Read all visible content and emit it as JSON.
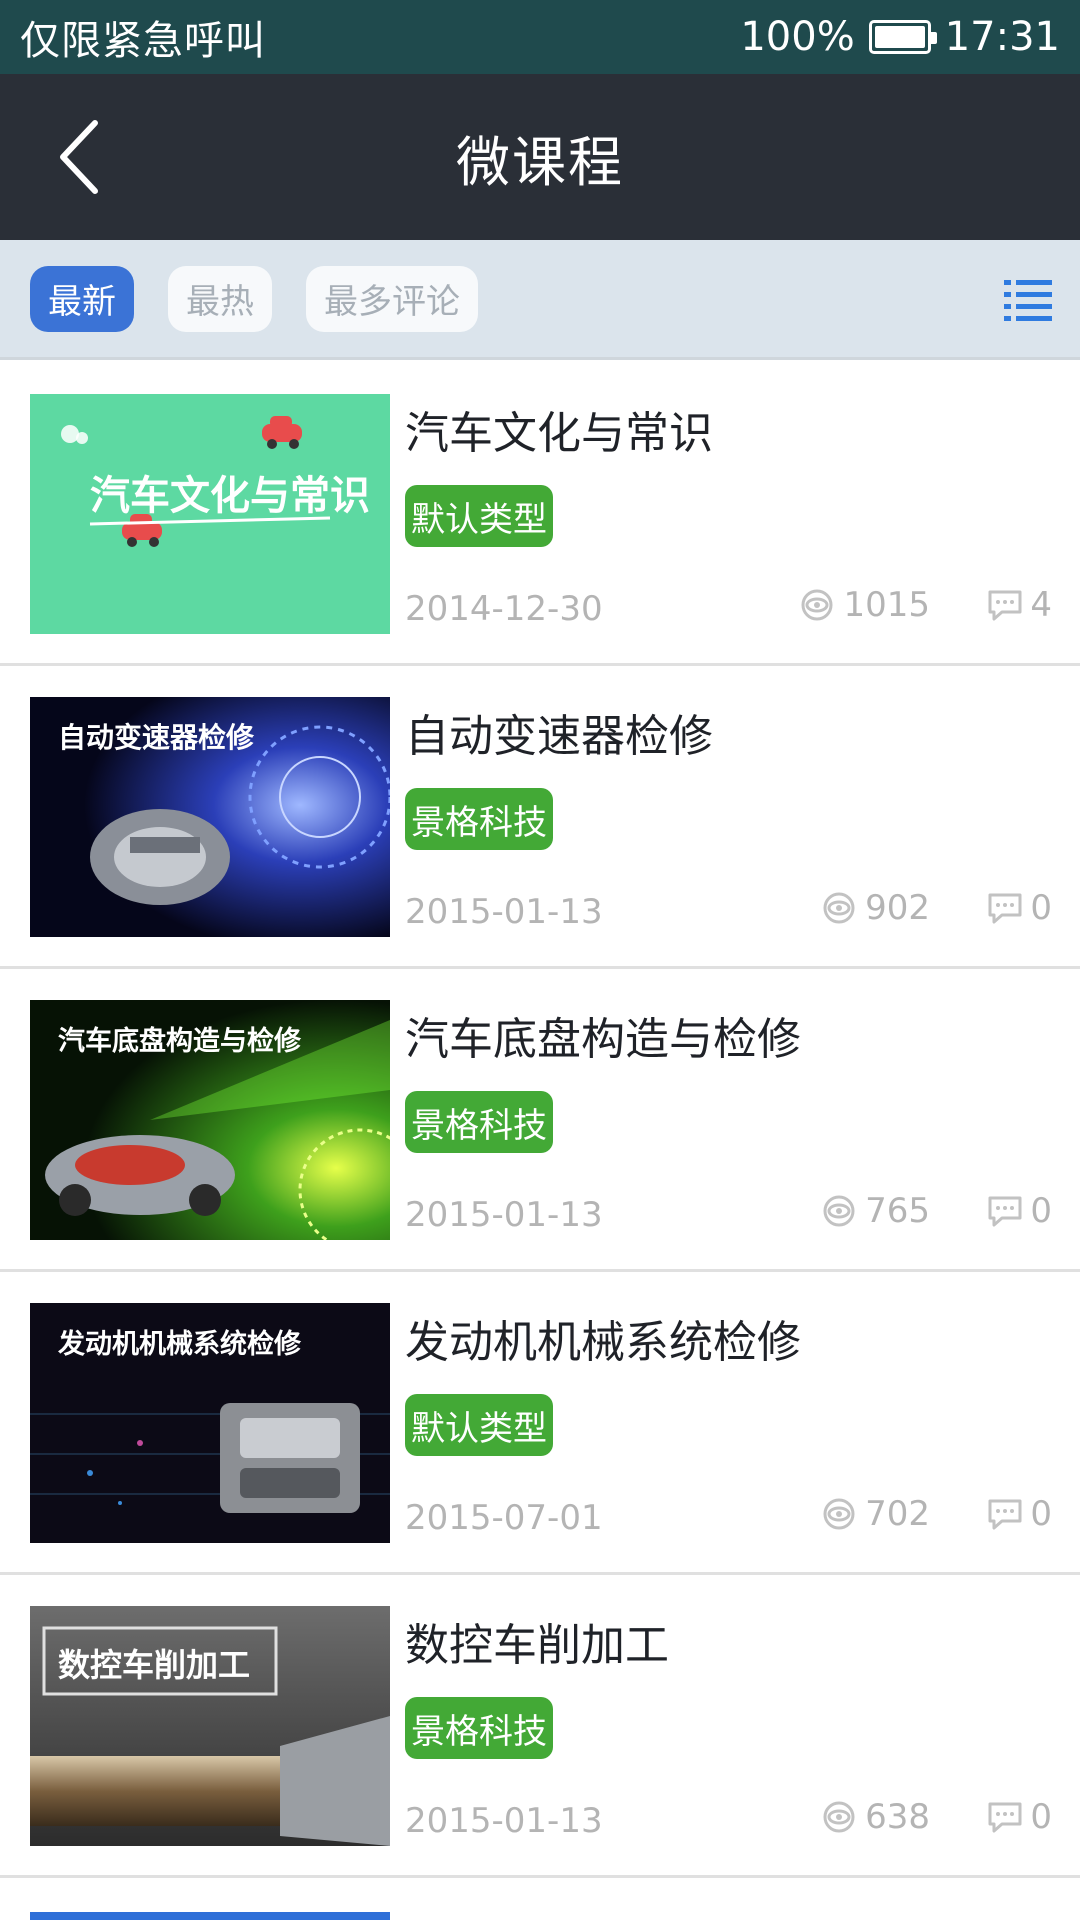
{
  "status_bar": {
    "carrier_text": "仅限紧急呼叫",
    "battery_percent": "100%",
    "battery_level": 1.0,
    "time": "17:31"
  },
  "header": {
    "title": "微课程",
    "back_icon": "chevron-left-icon"
  },
  "filters": {
    "tabs": [
      {
        "label": "最新",
        "active": true
      },
      {
        "label": "最热",
        "active": false
      },
      {
        "label": "最多评论",
        "active": false
      }
    ],
    "list_icon": "list-icon"
  },
  "colors": {
    "status_bar_bg": "#1f4a4d",
    "header_bg": "#2a2f37",
    "filter_bar_bg": "#dbe4ec",
    "active_chip": "#3b73d6",
    "tag_green": "#43a936",
    "list_icon_blue": "#2f7be0"
  },
  "courses": [
    {
      "title": "汽车文化与常识",
      "tag": "默认类型",
      "date": "2014-12-30",
      "views": "1015",
      "comments": "4",
      "thumb_text": "汽车文化与常识"
    },
    {
      "title": "自动变速器检修",
      "tag": "景格科技",
      "date": "2015-01-13",
      "views": "902",
      "comments": "0",
      "thumb_text": "自动变速器检修"
    },
    {
      "title": "汽车底盘构造与检修",
      "tag": "景格科技",
      "date": "2015-01-13",
      "views": "765",
      "comments": "0",
      "thumb_text": "汽车底盘构造与检修"
    },
    {
      "title": "发动机机械系统检修",
      "tag": "默认类型",
      "date": "2015-07-01",
      "views": "702",
      "comments": "0",
      "thumb_text": "发动机机械系统检修"
    },
    {
      "title": "数控车削加工",
      "tag": "景格科技",
      "date": "2015-01-13",
      "views": "638",
      "comments": "0",
      "thumb_text": "数控车削加工"
    }
  ]
}
